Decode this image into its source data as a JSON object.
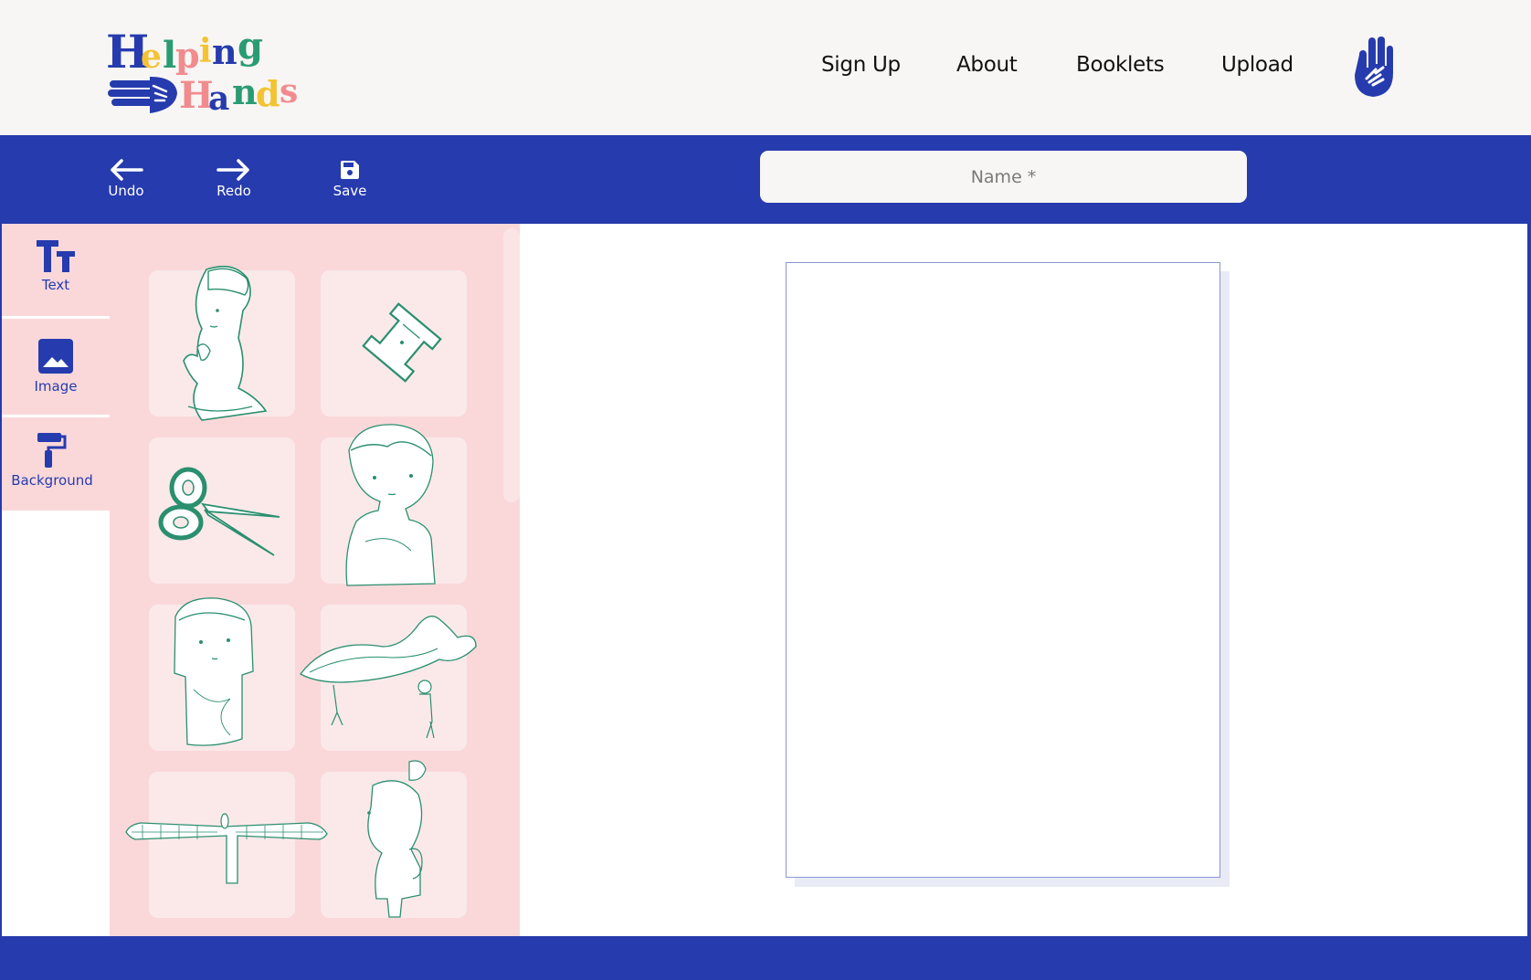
{
  "brand": {
    "logo_line1": "Helping",
    "logo_line2": "Hands",
    "colors": {
      "primary": "#263bad",
      "yellow": "#f3c332",
      "green": "#2a9b72",
      "pink": "#f28b8e",
      "panel_bg": "#fad8da",
      "header_bg": "#f8f6f4",
      "sketch": "#2a8f6e"
    }
  },
  "nav": {
    "items": [
      {
        "label": "Sign Up"
      },
      {
        "label": "About"
      },
      {
        "label": "Booklets"
      },
      {
        "label": "Upload"
      }
    ],
    "profile_icon": "raised-hand-icon"
  },
  "toolbar": {
    "undo_label": "Undo",
    "redo_label": "Redo",
    "save_label": "Save",
    "name_placeholder": "Name *",
    "name_value": ""
  },
  "sidebar": {
    "tabs": [
      {
        "label": "Text",
        "icon": "text-size-icon"
      },
      {
        "label": "Image",
        "icon": "image-icon"
      },
      {
        "label": "Background",
        "icon": "paint-roller-icon"
      }
    ]
  },
  "stickers": [
    {
      "name": "praying-boy"
    },
    {
      "name": "pencil-sharpener"
    },
    {
      "name": "scissors"
    },
    {
      "name": "boy-portrait"
    },
    {
      "name": "girl-portrait"
    },
    {
      "name": "dragon-dance"
    },
    {
      "name": "angel-of-the-north"
    },
    {
      "name": "girl-with-backpack"
    }
  ],
  "canvas": {
    "state": "blank page"
  }
}
